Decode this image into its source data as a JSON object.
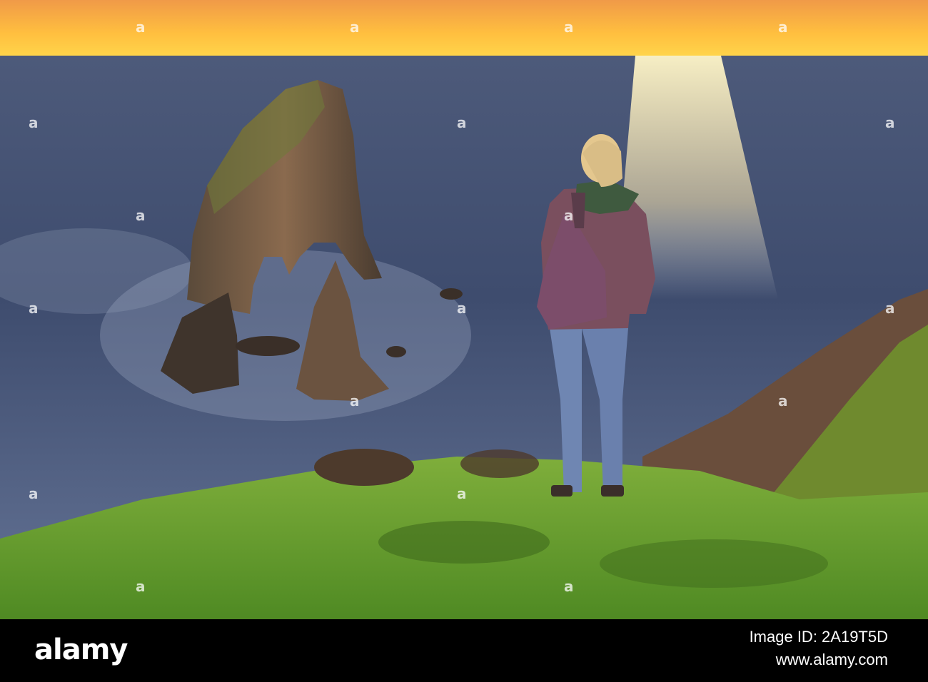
{
  "footer": {
    "brand": "alamy",
    "image_id": "Image ID: 2A19T5D",
    "website": "www.alamy.com"
  },
  "watermark": {
    "mark": "a"
  },
  "colors": {
    "sky_top": "#f6a24a",
    "horizon": "#ffd247",
    "sea": "#3f4f72",
    "grass": "#5f9a2c",
    "footer_bg": "#000000"
  }
}
